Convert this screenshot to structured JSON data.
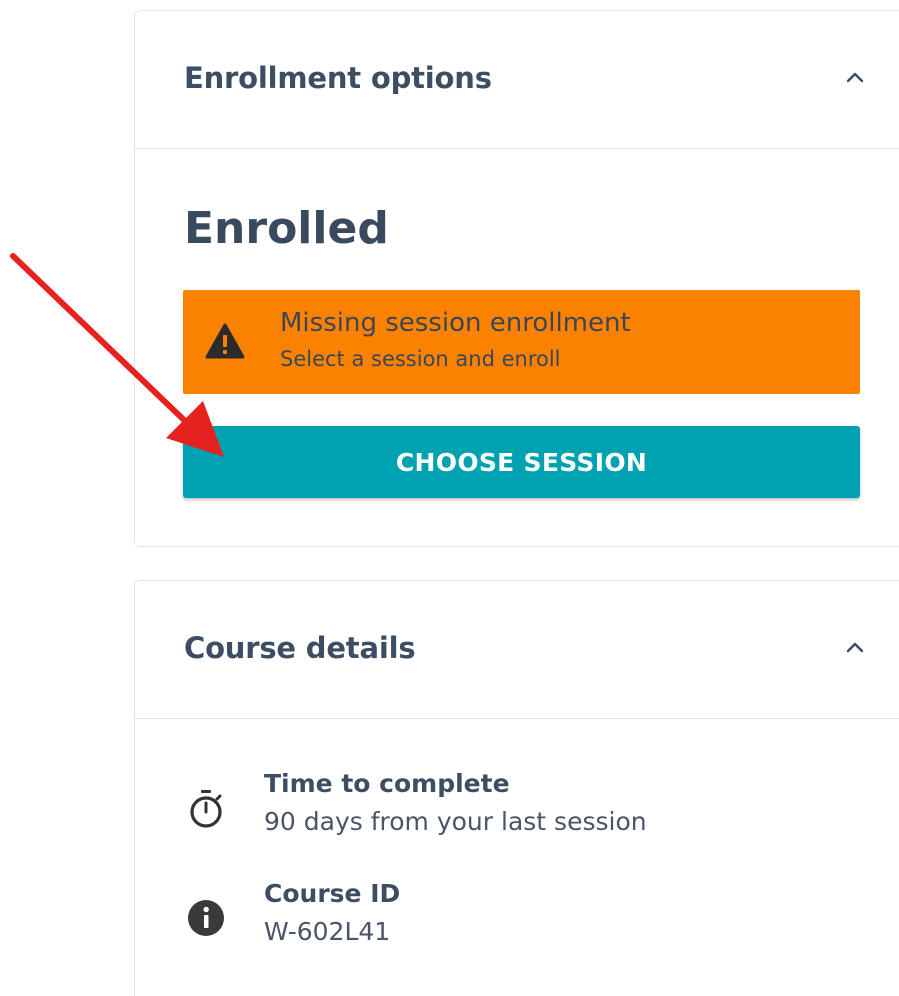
{
  "enrollment_card": {
    "title": "Enrollment options",
    "status_heading": "Enrolled",
    "alert": {
      "title": "Missing session enrollment",
      "subtitle": "Select a session and enroll",
      "icon": "warning-icon",
      "color": "#fb8200"
    },
    "choose_session_label": "CHOOSE SESSION",
    "choose_session_color": "#00a2b1"
  },
  "details_card": {
    "title": "Course details",
    "items": [
      {
        "icon": "stopwatch-icon",
        "label": "Time to complete",
        "value": "90 days from your last session"
      },
      {
        "icon": "info-icon",
        "label": "Course ID",
        "value": "W-602L41"
      }
    ]
  },
  "annotation": {
    "type": "arrow",
    "color": "#e5221f"
  }
}
